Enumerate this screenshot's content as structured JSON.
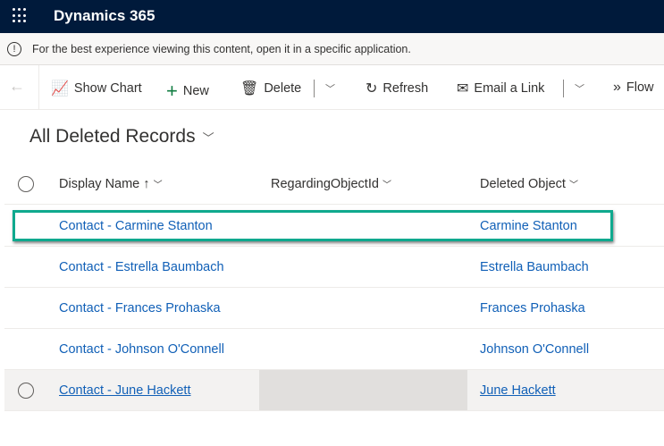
{
  "header": {
    "app_name": "Dynamics 365"
  },
  "notice": {
    "text": "For the best experience viewing this content, open it in a specific application."
  },
  "toolbar": {
    "show_chart": "Show Chart",
    "new": "New",
    "delete": "Delete",
    "refresh": "Refresh",
    "email_link": "Email a Link",
    "flow": "Flow"
  },
  "view": {
    "title": "All Deleted Records"
  },
  "table": {
    "columns": [
      "Display Name",
      "RegardingObjectId",
      "Deleted Object"
    ],
    "rows": [
      {
        "display_name": "Contact - Carmine Stanton",
        "regarding": "",
        "deleted_object": "Carmine Stanton"
      },
      {
        "display_name": "Contact - Estrella Baumbach",
        "regarding": "",
        "deleted_object": "Estrella Baumbach"
      },
      {
        "display_name": "Contact - Frances Prohaska",
        "regarding": "",
        "deleted_object": "Frances Prohaska"
      },
      {
        "display_name": "Contact - Johnson O'Connell",
        "regarding": "",
        "deleted_object": "Johnson O'Connell"
      },
      {
        "display_name": "Contact - June Hackett",
        "regarding": "",
        "deleted_object": "June Hackett"
      }
    ]
  },
  "colors": {
    "header_bg": "#001a3b",
    "link": "#1160b7",
    "highlight": "#0fa98e"
  }
}
